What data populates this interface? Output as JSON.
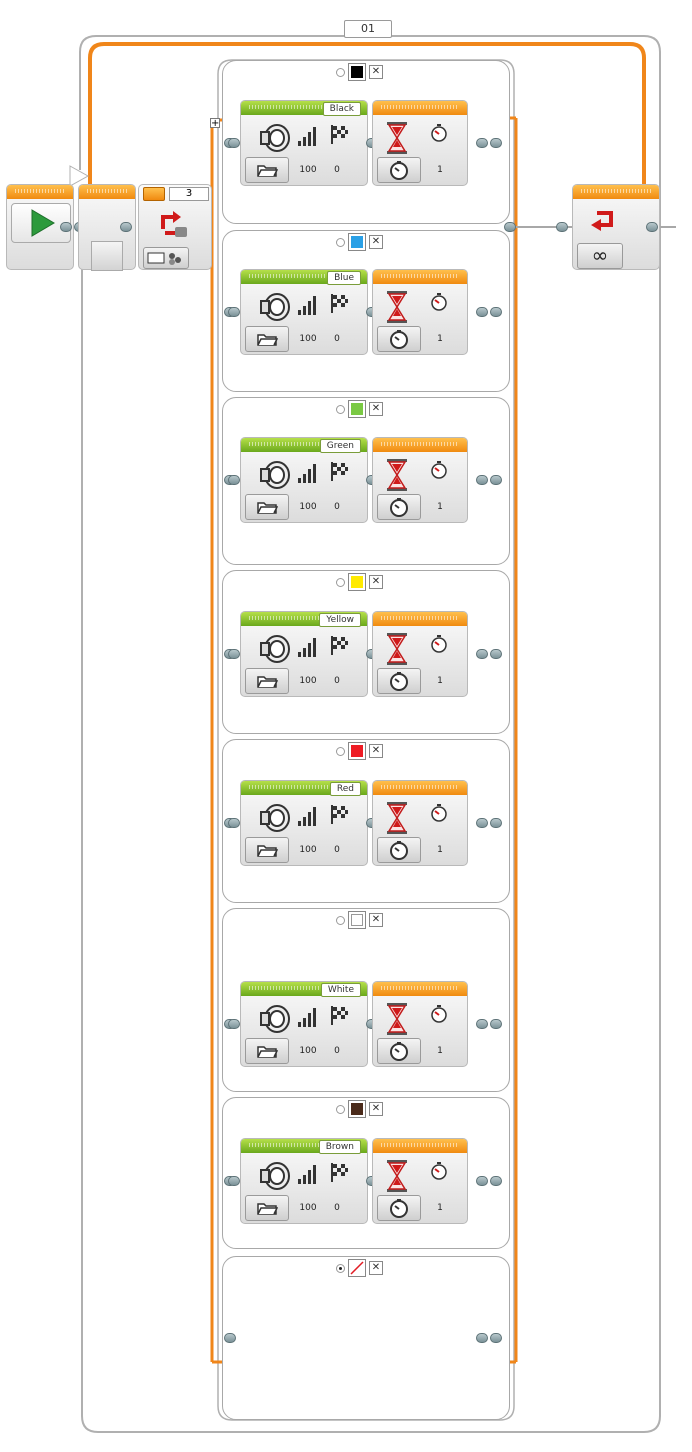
{
  "loop": {
    "label": "01",
    "mode_icon": "infinity-icon"
  },
  "switch": {
    "port": "3",
    "mode_icon": "color-sensor-icon"
  },
  "start_block": {
    "icon": "play-icon"
  },
  "cases": [
    {
      "color_name": "Black",
      "swatch": "#000000",
      "selected": false,
      "sound": {
        "label": "Black",
        "volume": "100",
        "play_type": "0"
      },
      "wait": {
        "seconds": "1"
      }
    },
    {
      "color_name": "Blue",
      "swatch": "#2aa0e6",
      "selected": false,
      "sound": {
        "label": "Blue",
        "volume": "100",
        "play_type": "0"
      },
      "wait": {
        "seconds": "1"
      }
    },
    {
      "color_name": "Green",
      "swatch": "#7ac943",
      "selected": false,
      "sound": {
        "label": "Green",
        "volume": "100",
        "play_type": "0"
      },
      "wait": {
        "seconds": "1"
      }
    },
    {
      "color_name": "Yellow",
      "swatch": "#ffea00",
      "selected": false,
      "sound": {
        "label": "Yellow",
        "volume": "100",
        "play_type": "0"
      },
      "wait": {
        "seconds": "1"
      }
    },
    {
      "color_name": "Red",
      "swatch": "#ee1c24",
      "selected": false,
      "sound": {
        "label": "Red",
        "volume": "100",
        "play_type": "0"
      },
      "wait": {
        "seconds": "1"
      }
    },
    {
      "color_name": "White",
      "swatch": "#ffffff",
      "selected": false,
      "sound": {
        "label": "White",
        "volume": "100",
        "play_type": "0"
      },
      "wait": {
        "seconds": "1"
      }
    },
    {
      "color_name": "Brown",
      "swatch": "#4a2a1a",
      "selected": false,
      "sound": {
        "label": "Brown",
        "volume": "100",
        "play_type": "0"
      },
      "wait": {
        "seconds": "1"
      }
    },
    {
      "color_name": "No Color",
      "swatch": "none",
      "selected": true
    }
  ],
  "ui": {
    "close_glyph": "✕",
    "add_case_glyph": "+"
  },
  "colors": {
    "flow_orange": "#f0861a",
    "sound_green": "#6aa81c",
    "wait_orange": "#f08a10",
    "start_green": "#2c9a3c"
  }
}
